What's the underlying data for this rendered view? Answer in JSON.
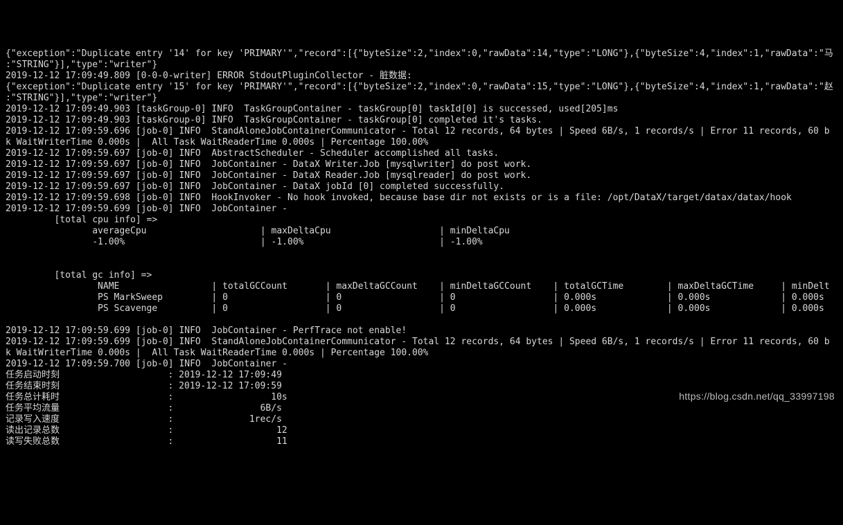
{
  "lines": [
    "{\"exception\":\"Duplicate entry '14' for key 'PRIMARY'\",\"record\":[{\"byteSize\":2,\"index\":0,\"rawData\":14,\"type\":\"LONG\"},{\"byteSize\":4,\"index\":1,\"rawData\":\"马",
    ":\"STRING\"}],\"type\":\"writer\"}",
    "2019-12-12 17:09:49.809 [0-0-0-writer] ERROR StdoutPluginCollector - 脏数据:",
    "{\"exception\":\"Duplicate entry '15' for key 'PRIMARY'\",\"record\":[{\"byteSize\":2,\"index\":0,\"rawData\":15,\"type\":\"LONG\"},{\"byteSize\":4,\"index\":1,\"rawData\":\"赵",
    ":\"STRING\"}],\"type\":\"writer\"}",
    "2019-12-12 17:09:49.903 [taskGroup-0] INFO  TaskGroupContainer - taskGroup[0] taskId[0] is successed, used[205]ms",
    "2019-12-12 17:09:49.903 [taskGroup-0] INFO  TaskGroupContainer - taskGroup[0] completed it's tasks.",
    "2019-12-12 17:09:59.696 [job-0] INFO  StandAloneJobContainerCommunicator - Total 12 records, 64 bytes | Speed 6B/s, 1 records/s | Error 11 records, 60 b",
    "k WaitWriterTime 0.000s |  All Task WaitReaderTime 0.000s | Percentage 100.00%",
    "2019-12-12 17:09:59.697 [job-0] INFO  AbstractScheduler - Scheduler accomplished all tasks.",
    "2019-12-12 17:09:59.697 [job-0] INFO  JobContainer - DataX Writer.Job [mysqlwriter] do post work.",
    "2019-12-12 17:09:59.697 [job-0] INFO  JobContainer - DataX Reader.Job [mysqlreader] do post work.",
    "2019-12-12 17:09:59.697 [job-0] INFO  JobContainer - DataX jobId [0] completed successfully.",
    "2019-12-12 17:09:59.698 [job-0] INFO  HookInvoker - No hook invoked, because base dir not exists or is a file: /opt/DataX/target/datax/datax/hook",
    "2019-12-12 17:09:59.699 [job-0] INFO  JobContainer -",
    "         [total cpu info] =>",
    "                averageCpu                     | maxDeltaCpu                    | minDeltaCpu",
    "                -1.00%                         | -1.00%                         | -1.00%",
    "",
    "",
    "         [total gc info] =>",
    "                 NAME                 | totalGCCount       | maxDeltaGCCount    | minDeltaGCCount    | totalGCTime        | maxDeltaGCTime     | minDelt",
    "                 PS MarkSweep         | 0                  | 0                  | 0                  | 0.000s             | 0.000s             | 0.000s",
    "                 PS Scavenge          | 0                  | 0                  | 0                  | 0.000s             | 0.000s             | 0.000s",
    "",
    "2019-12-12 17:09:59.699 [job-0] INFO  JobContainer - PerfTrace not enable!",
    "2019-12-12 17:09:59.699 [job-0] INFO  StandAloneJobContainerCommunicator - Total 12 records, 64 bytes | Speed 6B/s, 1 records/s | Error 11 records, 60 b",
    "k WaitWriterTime 0.000s |  All Task WaitReaderTime 0.000s | Percentage 100.00%",
    "2019-12-12 17:09:59.700 [job-0] INFO  JobContainer -",
    "任务启动时刻                    : 2019-12-12 17:09:49",
    "任务结束时刻                    : 2019-12-12 17:09:59",
    "任务总计耗时                    :                  10s",
    "任务平均流量                    :                6B/s",
    "记录写入速度                    :              1rec/s",
    "读出记录总数                    :                   12",
    "读写失败总数                    :                   11"
  ],
  "watermark": "https://blog.csdn.net/qq_33997198"
}
